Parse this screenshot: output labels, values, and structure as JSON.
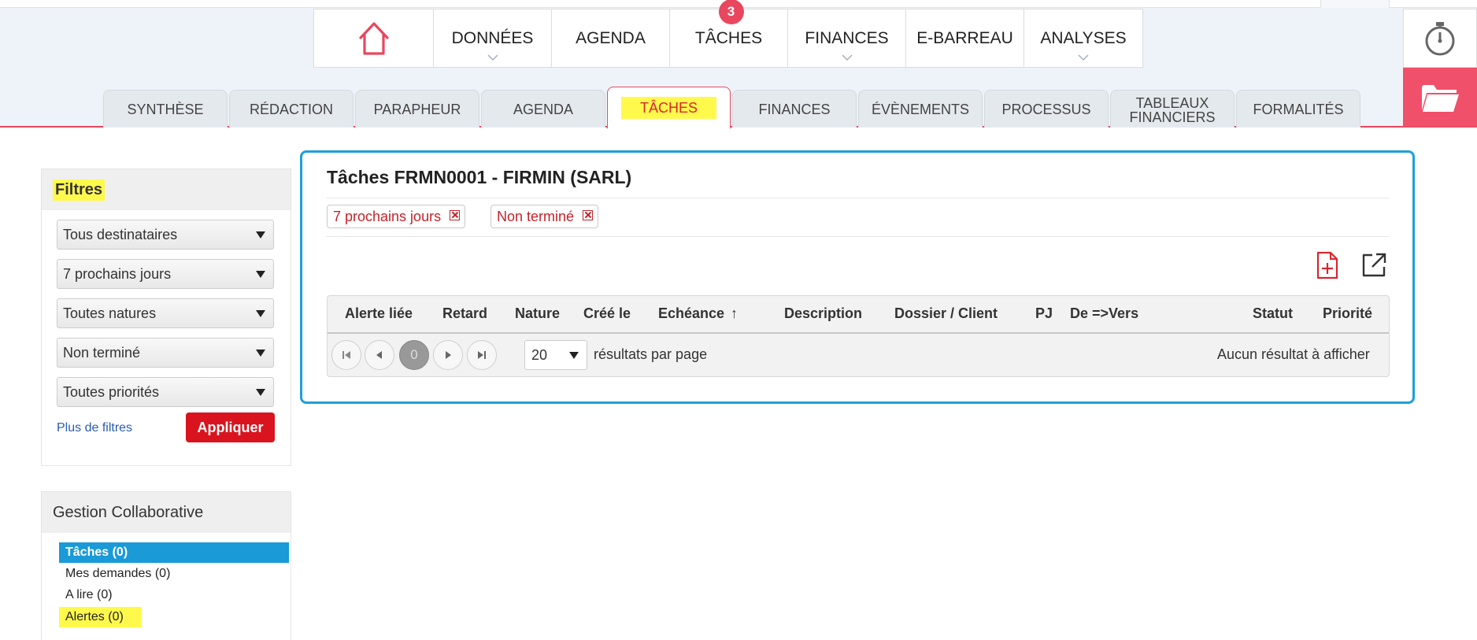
{
  "mainnav": {
    "items": [
      {
        "label": "DONNÉES",
        "chevron": true
      },
      {
        "label": "AGENDA",
        "chevron": false
      },
      {
        "label": "TÂCHES",
        "chevron": false,
        "badge": "3"
      },
      {
        "label": "FINANCES",
        "chevron": true
      },
      {
        "label": "E-BARREAU",
        "chevron": false
      },
      {
        "label": "ANALYSES",
        "chevron": true
      }
    ]
  },
  "subtabs": [
    {
      "line1": "SYNTHÈSE",
      "line2": ""
    },
    {
      "line1": "RÉDACTION",
      "line2": ""
    },
    {
      "line1": "PARAPHEUR",
      "line2": ""
    },
    {
      "line1": "AGENDA",
      "line2": ""
    },
    {
      "line1": "TÂCHES",
      "line2": ""
    },
    {
      "line1": "FINANCES",
      "line2": ""
    },
    {
      "line1": "ÉVÈNEMENTS",
      "line2": ""
    },
    {
      "line1": "PROCESSUS",
      "line2": ""
    },
    {
      "line1": "TABLEAUX",
      "line2": "FINANCIERS"
    },
    {
      "line1": "FORMALITÉS",
      "line2": ""
    }
  ],
  "filters": {
    "title": "Filtres",
    "selects": [
      "Tous destinataires",
      "7 prochains jours",
      "Toutes natures",
      "Non terminé",
      "Toutes priorités"
    ],
    "more_link": "Plus de filtres",
    "apply_label": "Appliquer"
  },
  "collab": {
    "title": "Gestion Collaborative",
    "items": [
      "Tâches (0)",
      "Mes demandes (0)",
      "A lire (0)",
      "Alertes (0)"
    ]
  },
  "main": {
    "title": "Tâches FRMN0001 - FIRMIN (SARL)",
    "chips": [
      "7 prochains jours",
      "Non terminé"
    ],
    "columns": [
      "Alerte liée",
      "Retard",
      "Nature",
      "Créé le",
      "Echéance",
      "Description",
      "Dossier / Client",
      "PJ",
      "De =>Vers",
      "Statut",
      "Priorité"
    ],
    "sort_indicator": "↑",
    "pager": {
      "current_page": "0",
      "page_size": "20",
      "page_size_label": "résultats par page",
      "empty_text": "Aucun résultat à afficher"
    }
  },
  "colors": {
    "accent": "#e8475f",
    "primary_border": "#1ea0d8",
    "apply_button": "#d9141e",
    "highlight": "#fff94c",
    "active_item": "#1a9ad6"
  }
}
